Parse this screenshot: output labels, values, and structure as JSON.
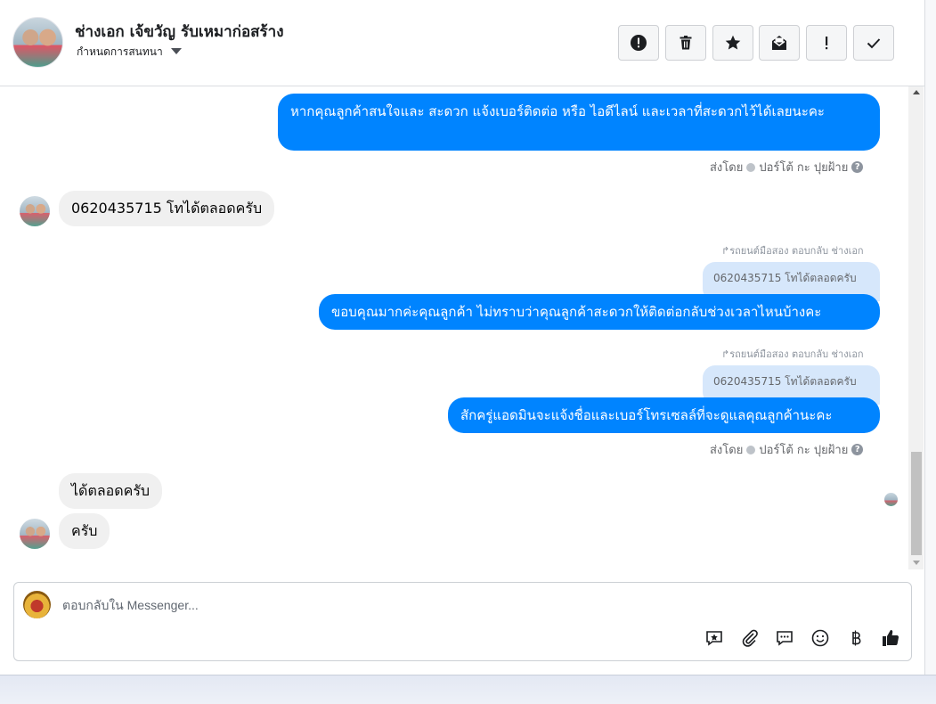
{
  "header": {
    "contact_name": "ช่างเอก เจ้ขวัญ รับเหมาก่อสร้าง",
    "assign_label": "กำหนดการสนทนา",
    "toolbar": [
      {
        "name": "report-button",
        "icon": "alert-circle-icon"
      },
      {
        "name": "delete-button",
        "icon": "trash-icon"
      },
      {
        "name": "star-button",
        "icon": "star-icon"
      },
      {
        "name": "mark-unread-button",
        "icon": "envelope-icon"
      },
      {
        "name": "priority-button",
        "icon": "exclamation-icon"
      },
      {
        "name": "done-button",
        "icon": "checkmark-icon"
      }
    ]
  },
  "messages": {
    "m1": {
      "text": "หากคุณลูกค้าสนใจและ สะดวก แจ้งเบอร์ติดต่อ หรือ ไอดีไลน์ และเวลาที่สะดวกไว้ได้เลยนะคะ"
    },
    "m1_sent_by": "ส่งโดย",
    "m1_sender": "ปอร์โต้ กะ ปุยฝ้าย",
    "m2": {
      "text": "0620435715 โทได้ตลอดครับ"
    },
    "m3_reply_hint": "↱รถยนต์มือสอง ตอบกลับ ช่างเอก",
    "m3_quote": "0620435715 โทได้ตลอดครับ",
    "m3": {
      "text": "ขอบคุณมากค่ะคุณลูกค้า ไม่ทราบว่าคุณลูกค้าสะดวกให้ติดต่อกลับช่วงเวลาไหนบ้างคะ"
    },
    "m4_reply_hint": "↱รถยนต์มือสอง ตอบกลับ ช่างเอก",
    "m4_quote": "0620435715 โทได้ตลอดครับ",
    "m4": {
      "text": "สักครู่แอดมินจะแจ้งชื่อและเบอร์โทรเซลล์ที่จะดูแลคุณลูกค้านะคะ"
    },
    "m4_sent_by": "ส่งโดย",
    "m4_sender": "ปอร์โต้ กะ ปุยฝ้าย",
    "m5": {
      "text": "ได้ตลอดครับ"
    },
    "m6": {
      "text": "ครับ"
    }
  },
  "composer": {
    "placeholder": "ตอบกลับใน Messenger...",
    "icons": [
      "saved-reply-icon",
      "attachment-icon",
      "quick-reply-icon",
      "emoji-icon",
      "baht-icon",
      "thumbs-up-icon"
    ]
  },
  "colors": {
    "accent": "#0084ff",
    "incoming": "#f0f0f0",
    "quote": "#d6e7fb"
  }
}
